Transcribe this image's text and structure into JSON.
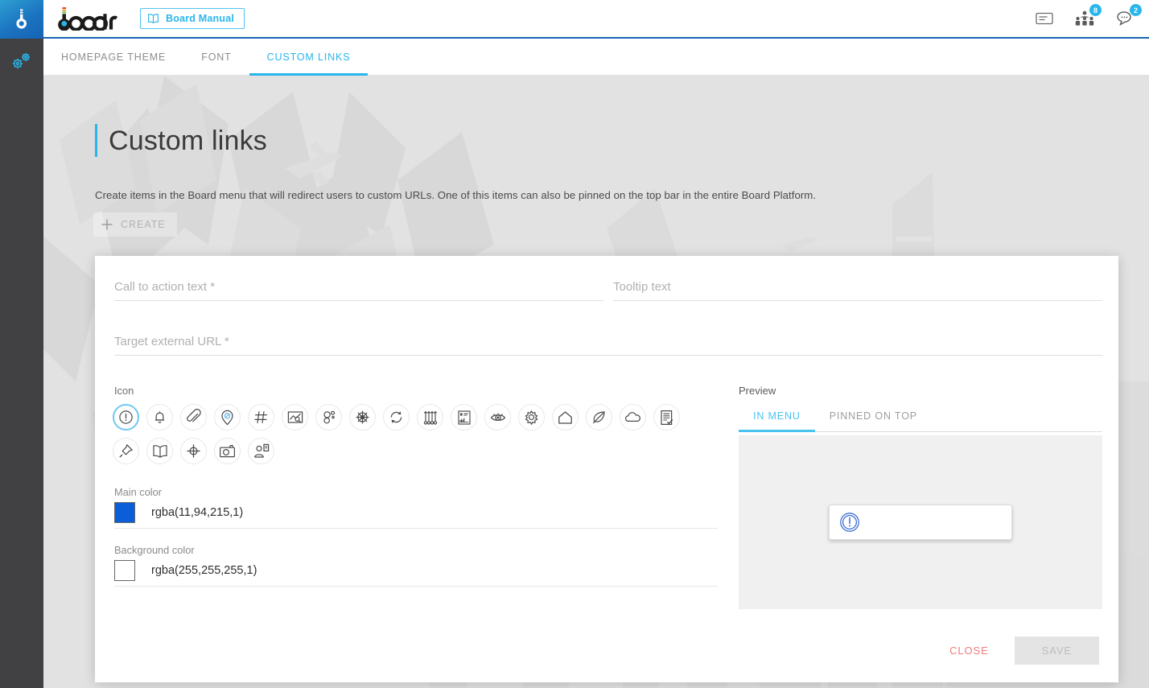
{
  "rail": {
    "logo_icon": "board-b-logo-icon",
    "settings_icon": "gears-icon"
  },
  "topbar": {
    "brand": "board",
    "manual_button": {
      "label": "Board Manual",
      "icon": "book-icon"
    },
    "right_icons": [
      {
        "name": "card-icon",
        "badge": null
      },
      {
        "name": "people-group-icon",
        "badge": "8"
      },
      {
        "name": "chat-bubble-icon",
        "badge": "2"
      }
    ]
  },
  "tabs": [
    {
      "label": "HOMEPAGE THEME",
      "active": false
    },
    {
      "label": "FONT",
      "active": false
    },
    {
      "label": "CUSTOM LINKS",
      "active": true
    }
  ],
  "page": {
    "title": "Custom links",
    "description": "Create items in the Board menu that will redirect users to custom URLs. One of this items can also be pinned on the top bar in the entire Board Platform.",
    "create_button": {
      "label": "CREATE",
      "icon": "plus-icon"
    }
  },
  "dialog": {
    "fields": {
      "call_to_action": {
        "placeholder": "Call to action text *",
        "value": ""
      },
      "tooltip": {
        "placeholder": "Tooltip text",
        "value": ""
      },
      "target_url": {
        "placeholder": "Target external URL *",
        "value": ""
      }
    },
    "icon_section": {
      "label": "Icon",
      "selected_index": 0,
      "icons": [
        "alert-circle-icon",
        "bell-icon",
        "paperclip-icon",
        "location-pin-icon",
        "hashtag-icon",
        "chart-image-icon",
        "bubbles-icon",
        "ship-wheel-icon",
        "refresh-icon",
        "sliders-icon",
        "crop-frame-icon",
        "eye-icon",
        "gear-icon",
        "home-icon",
        "leaf-icon",
        "cloud-icon",
        "document-check-icon",
        "pushpin-icon",
        "open-book-icon",
        "crosshair-icon",
        "camera-icon",
        "user-clipboard-icon"
      ]
    },
    "colors": {
      "main": {
        "label": "Main color",
        "value": "rgba(11,94,215,1)",
        "hex": "#0b5ed7"
      },
      "background": {
        "label": "Background color",
        "value": "rgba(255,255,255,1)",
        "hex": "#ffffff"
      }
    },
    "preview": {
      "label": "Preview",
      "tabs": [
        {
          "label": "IN MENU",
          "active": true
        },
        {
          "label": "PINNED ON TOP",
          "active": false
        }
      ],
      "card_icon": "alert-circle-icon",
      "card_text": ""
    },
    "footer": {
      "close_label": "CLOSE",
      "save_label": "SAVE"
    }
  },
  "theme": {
    "accent": "#29b6ea",
    "rail_dark": "#414042",
    "brand_blue": "#1763b4",
    "danger": "#ef7b7b"
  }
}
